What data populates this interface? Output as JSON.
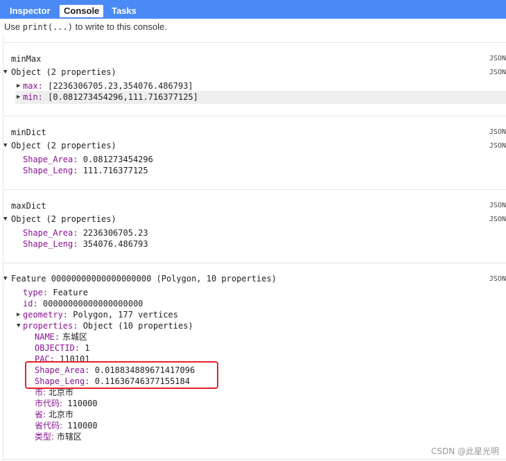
{
  "tabs": [
    {
      "label": "Inspector",
      "active": false
    },
    {
      "label": "Console",
      "active": true
    },
    {
      "label": "Tasks",
      "active": false
    }
  ],
  "hint": {
    "prefix": "Use ",
    "code": "print(...)",
    "suffix": " to write to this console."
  },
  "json_label": "JSON",
  "blocks": {
    "minmax": {
      "title": "minMax",
      "summary": "Object (2 properties)",
      "max_key": "max:",
      "max_value": " [2236306705.23,354076.486793]",
      "min_key": "min:",
      "min_value": " [0.081273454296,111.716377125]"
    },
    "mindict": {
      "title": "minDict",
      "summary": "Object (2 properties)",
      "area_key": "Shape_Area:",
      "area_value": " 0.081273454296",
      "leng_key": "Shape_Leng:",
      "leng_value": " 111.716377125"
    },
    "maxdict": {
      "title": "maxDict",
      "summary": "Object (2 properties)",
      "area_key": "Shape_Area:",
      "area_value": " 2236306705.23",
      "leng_key": "Shape_Leng:",
      "leng_value": " 354076.486793"
    },
    "feature": {
      "summary": "Feature 00000000000000000000 (Polygon, 10 properties)",
      "type_key": "type:",
      "type_value": " Feature",
      "id_key": "id:",
      "id_value": " 00000000000000000000",
      "geometry_key": "geometry:",
      "geometry_value": " Polygon, 177 vertices",
      "properties_key": "properties:",
      "properties_value": " Object (10 properties)",
      "props": [
        {
          "key": "NAME:",
          "value": " 东城区"
        },
        {
          "key": "OBJECTID:",
          "value": " 1"
        },
        {
          "key": "PAC:",
          "value": " 110101"
        },
        {
          "key": "Shape_Area:",
          "value": " 0.018834889671417096"
        },
        {
          "key": "Shape_Leng:",
          "value": " 0.11636746377155184"
        },
        {
          "key": "市:",
          "value": " 北京市"
        },
        {
          "key": "市代码:",
          "value": " 110000"
        },
        {
          "key": "省:",
          "value": " 北京市"
        },
        {
          "key": "省代码:",
          "value": " 110000"
        },
        {
          "key": "类型:",
          "value": " 市辖区"
        }
      ]
    }
  },
  "watermark": "CSDN @此星光明",
  "colors": {
    "tabbar": "#4a8af4",
    "key": "#881391",
    "highlight_box": "#e5232b"
  }
}
